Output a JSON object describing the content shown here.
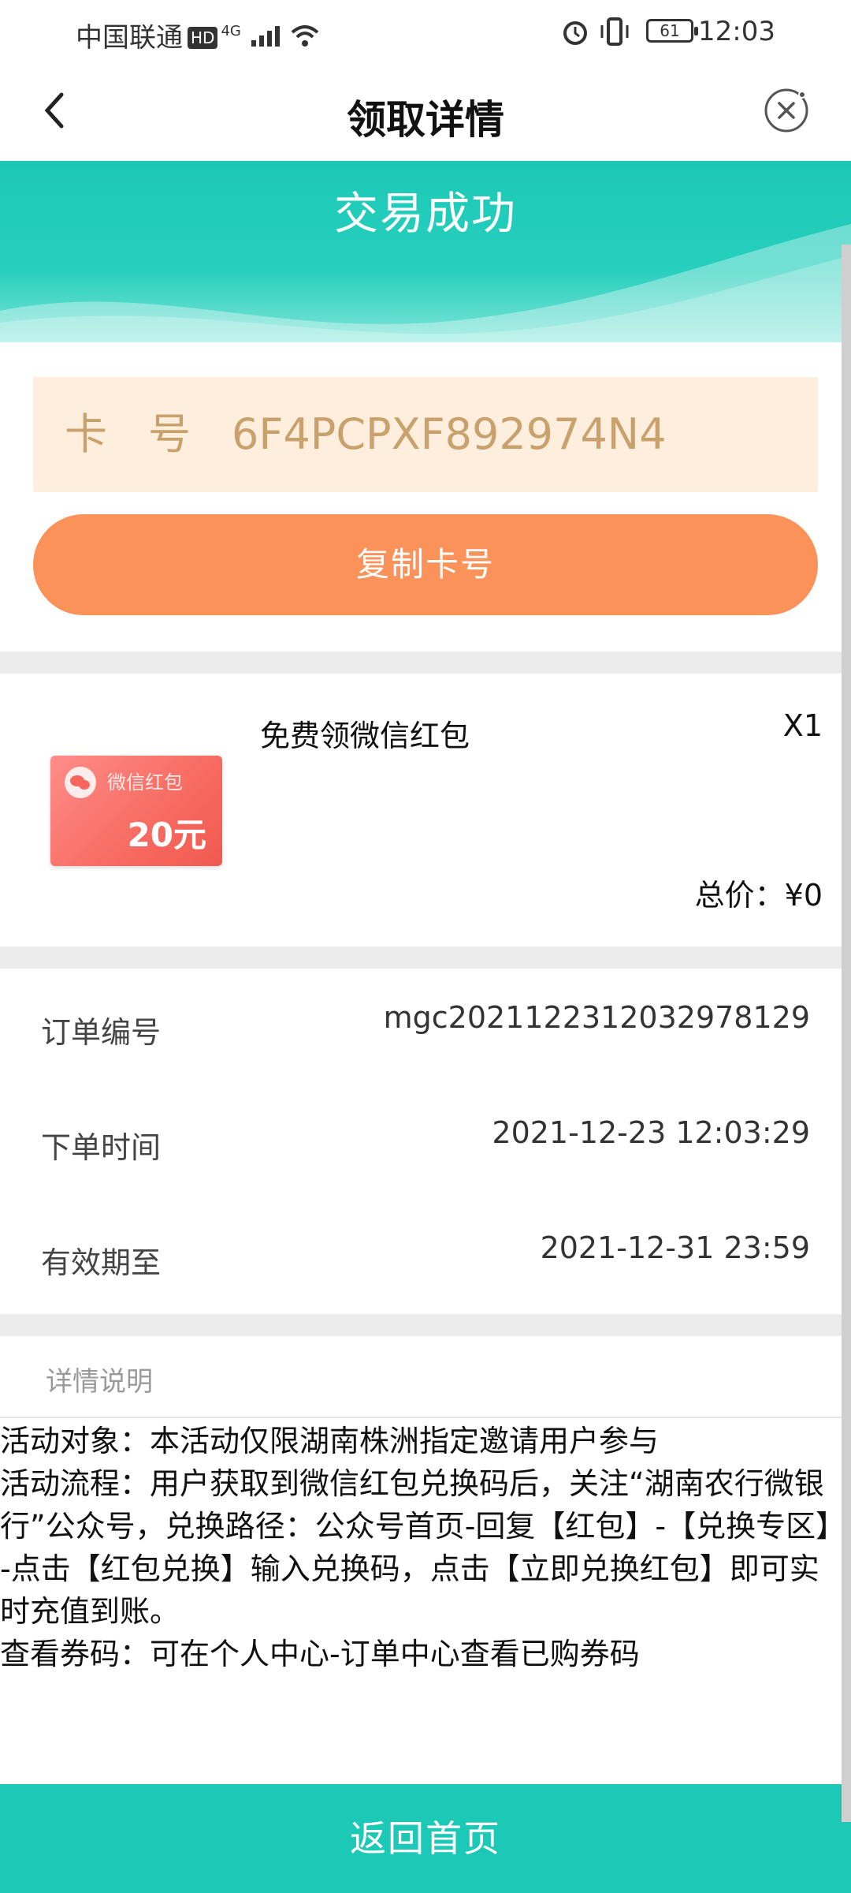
{
  "status_bar": {
    "carrier": "中国联通",
    "hd_badge": "HD",
    "network": "4G",
    "battery": "61",
    "time": "12:03",
    "icons": [
      "signal-icon",
      "wifi-icon",
      "alarm-icon",
      "vibrate-icon",
      "battery-icon"
    ]
  },
  "header": {
    "title": "领取详情",
    "back_icon": "back-arrow-icon",
    "close_icon": "close-circle-icon"
  },
  "hero": {
    "title": "交易成功"
  },
  "card": {
    "label": "卡号",
    "number": "6F4PCPXF892974N4",
    "copy_label": "复制卡号"
  },
  "product": {
    "thumb_label": "微信红包",
    "thumb_amount": "20元",
    "name": "免费领微信红包",
    "quantity": "X1",
    "total": "总价：¥0"
  },
  "order": {
    "rows": [
      {
        "key": "订单编号",
        "value": "mgc2021122312032978129"
      },
      {
        "key": "下单时间",
        "value": "2021-12-23 12:03:29"
      },
      {
        "key": "有效期至",
        "value": "2021-12-31 23:59"
      }
    ]
  },
  "description": {
    "heading": "详情说明",
    "text": "活动对象：本活动仅限湖南株洲指定邀请用户参与\n活动流程：用户获取到微信红包兑换码后，关注“湖南农行微银行”公众号，兑换路径：公众号首页-回复【红包】-【兑换专区】-点击【红包兑换】输入兑换码，点击【立即兑换红包】即可实时充值到账。\n查看券码：可在个人中心-订单中心查看已购券码"
  },
  "footer": {
    "button_label": "返回首页"
  },
  "colors": {
    "teal": "#1cc9b6",
    "orange": "#fa9259",
    "card_bg": "#fdeedd",
    "card_text": "#c8a16c",
    "divider": "#ececec"
  }
}
